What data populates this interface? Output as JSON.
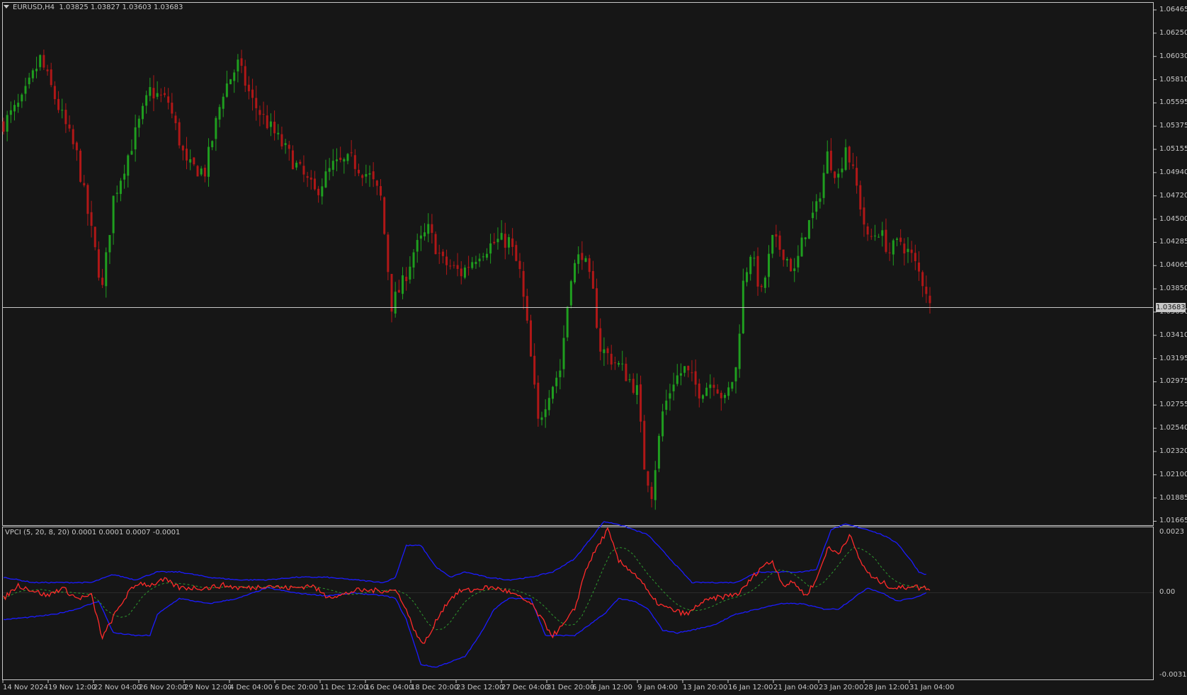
{
  "main_header": {
    "symbol": "EURUSD,H4",
    "ohlc": "1.03825 1.03827 1.03603 1.03683"
  },
  "indicator_header": "VPCI (5, 20, 8, 20) 0.0001 0.0001 0.0007 -0.0001",
  "current_price": "1.03683",
  "price_axis": [
    "1.06465",
    "1.06250",
    "1.06030",
    "1.05810",
    "1.05595",
    "1.05375",
    "1.05155",
    "1.04940",
    "1.04720",
    "1.04500",
    "1.04285",
    "1.04065",
    "1.03850",
    "1.03630",
    "1.03410",
    "1.03195",
    "1.02975",
    "1.02755",
    "1.02540",
    "1.02320",
    "1.02100",
    "1.01885",
    "1.01665"
  ],
  "indicator_axis": [
    "0.0023",
    "0.00",
    "-0.0031"
  ],
  "time_axis": [
    "14 Nov 2024",
    "19 Nov 12:00",
    "22 Nov 04:00",
    "26 Nov 20:00",
    "29 Nov 12:00",
    "4 Dec 04:00",
    "6 Dec 20:00",
    "11 Dec 12:00",
    "16 Dec 04:00",
    "18 Dec 20:00",
    "23 Dec 12:00",
    "27 Dec 04:00",
    "31 Dec 20:00",
    "6 Jan 12:00",
    "9 Jan 04:00",
    "13 Jan 20:00",
    "16 Jan 12:00",
    "21 Jan 04:00",
    "23 Jan 20:00",
    "28 Jan 12:00",
    "31 Jan 04:00"
  ],
  "colors": {
    "background": "#161616",
    "bull": "#1f9e1f",
    "bear": "#b01717",
    "vpci": "#ff2a2a",
    "signal": "#2e9a2e",
    "bands": "#1c1cff",
    "grid_text": "#c8c8c8"
  },
  "chart_data": {
    "type": "candlestick",
    "price_range": [
      1.01665,
      1.06465
    ],
    "close_anchors": [
      [
        0,
        1.054
      ],
      [
        5,
        1.056
      ],
      [
        10,
        1.06
      ],
      [
        15,
        1.0555
      ],
      [
        20,
        1.051
      ],
      [
        25,
        1.042
      ],
      [
        27,
        1.0385
      ],
      [
        30,
        1.047
      ],
      [
        35,
        1.052
      ],
      [
        40,
        1.057
      ],
      [
        45,
        1.056
      ],
      [
        50,
        1.05
      ],
      [
        55,
        1.0495
      ],
      [
        60,
        1.057
      ],
      [
        64,
        1.0595
      ],
      [
        68,
        1.056
      ],
      [
        72,
        1.054
      ],
      [
        76,
        1.052
      ],
      [
        80,
        1.05
      ],
      [
        85,
        1.0475
      ],
      [
        90,
        1.05
      ],
      [
        95,
        1.0505
      ],
      [
        100,
        1.049
      ],
      [
        103,
        1.047
      ],
      [
        106,
        1.037
      ],
      [
        109,
        1.039
      ],
      [
        112,
        1.042
      ],
      [
        116,
        1.044
      ],
      [
        120,
        1.041
      ],
      [
        125,
        1.04
      ],
      [
        130,
        1.042
      ],
      [
        135,
        1.043
      ],
      [
        138,
        1.043
      ],
      [
        141,
        1.04
      ],
      [
        143,
        1.035
      ],
      [
        146,
        1.026
      ],
      [
        149,
        1.029
      ],
      [
        152,
        1.031
      ],
      [
        155,
        1.04
      ],
      [
        158,
        1.042
      ],
      [
        161,
        1.038
      ],
      [
        163,
        1.033
      ],
      [
        166,
        1.032
      ],
      [
        169,
        1.031
      ],
      [
        173,
        1.029
      ],
      [
        175,
        1.022
      ],
      [
        177,
        1.0195
      ],
      [
        180,
        1.027
      ],
      [
        183,
        1.03
      ],
      [
        186,
        1.031
      ],
      [
        190,
        1.029
      ],
      [
        194,
        1.03
      ],
      [
        197,
        1.028
      ],
      [
        200,
        1.031
      ],
      [
        202,
        1.039
      ],
      [
        204,
        1.042
      ],
      [
        207,
        1.038
      ],
      [
        210,
        1.043
      ],
      [
        213,
        1.042
      ],
      [
        216,
        1.04
      ],
      [
        219,
        1.044
      ],
      [
        222,
        1.046
      ],
      [
        225,
        1.051
      ],
      [
        228,
        1.049
      ],
      [
        230,
        1.052
      ],
      [
        233,
        1.048
      ],
      [
        236,
        1.043
      ],
      [
        239,
        1.044
      ],
      [
        242,
        1.042
      ],
      [
        245,
        1.043
      ],
      [
        248,
        1.0415
      ],
      [
        250,
        1.04
      ],
      [
        252,
        1.0385
      ],
      [
        253,
        1.0368
      ]
    ],
    "indicator_range": [
      -0.0031,
      0.0023
    ],
    "vpci_anchors": [
      [
        0,
        -0.0002
      ],
      [
        4,
        0.0003
      ],
      [
        8,
        0.0001
      ],
      [
        12,
        -0.0001
      ],
      [
        16,
        0.0002
      ],
      [
        20,
        -0.0002
      ],
      [
        24,
        -0.0001
      ],
      [
        27,
        -0.0017
      ],
      [
        30,
        -0.0009
      ],
      [
        34,
        0.0
      ],
      [
        37,
        0.0004
      ],
      [
        40,
        0.0003
      ],
      [
        44,
        0.0005
      ],
      [
        48,
        0.0002
      ],
      [
        52,
        0.0002
      ],
      [
        56,
        0.0002
      ],
      [
        60,
        0.0003
      ],
      [
        64,
        0.0002
      ],
      [
        68,
        0.0002
      ],
      [
        72,
        0.0003
      ],
      [
        76,
        0.0002
      ],
      [
        80,
        0.0002
      ],
      [
        84,
        0.0003
      ],
      [
        88,
        -0.0001
      ],
      [
        92,
        -0.0001
      ],
      [
        96,
        0.0001
      ],
      [
        100,
        0.0001
      ],
      [
        104,
        0.0001
      ],
      [
        107,
        0.0001
      ],
      [
        109,
        -0.0003
      ],
      [
        111,
        -0.001
      ],
      [
        114,
        -0.0019
      ],
      [
        116,
        -0.0017
      ],
      [
        119,
        -0.0008
      ],
      [
        122,
        -0.0002
      ],
      [
        125,
        0.0001
      ],
      [
        128,
        0.0001
      ],
      [
        131,
        0.0002
      ],
      [
        134,
        0.0002
      ],
      [
        137,
        0.0001
      ],
      [
        140,
        -0.0001
      ],
      [
        144,
        -0.0004
      ],
      [
        148,
        -0.0012
      ],
      [
        150,
        -0.0016
      ],
      [
        153,
        -0.0012
      ],
      [
        156,
        -0.0006
      ],
      [
        159,
        0.0009
      ],
      [
        162,
        0.0017
      ],
      [
        165,
        0.0024
      ],
      [
        168,
        0.0012
      ],
      [
        171,
        0.0009
      ],
      [
        174,
        0.0005
      ],
      [
        177,
        -0.0002
      ],
      [
        180,
        -0.0005
      ],
      [
        184,
        -0.0007
      ],
      [
        187,
        -0.0008
      ],
      [
        190,
        -0.0004
      ],
      [
        194,
        -0.0002
      ],
      [
        198,
        -0.0001
      ],
      [
        201,
        0.0
      ],
      [
        204,
        0.0005
      ],
      [
        207,
        0.001
      ],
      [
        210,
        0.0012
      ],
      [
        213,
        0.0003
      ],
      [
        216,
        0.0004
      ],
      [
        219,
        -0.0001
      ],
      [
        222,
        0.0005
      ],
      [
        225,
        0.0017
      ],
      [
        228,
        0.0015
      ],
      [
        231,
        0.0022
      ],
      [
        234,
        0.0012
      ],
      [
        237,
        0.0006
      ],
      [
        240,
        0.0004
      ],
      [
        243,
        0.0002
      ],
      [
        246,
        0.0002
      ],
      [
        248,
        0.0003
      ],
      [
        250,
        0.0002
      ],
      [
        253,
        0.0002
      ]
    ],
    "upper_band_anchors": [
      [
        0,
        0.0006
      ],
      [
        8,
        0.0004
      ],
      [
        16,
        0.0004
      ],
      [
        24,
        0.0004
      ],
      [
        30,
        0.0007
      ],
      [
        36,
        0.0005
      ],
      [
        42,
        0.0008
      ],
      [
        48,
        0.0008
      ],
      [
        56,
        0.0006
      ],
      [
        64,
        0.0005
      ],
      [
        72,
        0.0005
      ],
      [
        80,
        0.0006
      ],
      [
        88,
        0.0006
      ],
      [
        96,
        0.0005
      ],
      [
        104,
        0.0004
      ],
      [
        107,
        0.0006
      ],
      [
        110,
        0.0018
      ],
      [
        114,
        0.0018
      ],
      [
        118,
        0.001
      ],
      [
        122,
        0.0006
      ],
      [
        126,
        0.0008
      ],
      [
        132,
        0.0006
      ],
      [
        138,
        0.0005
      ],
      [
        144,
        0.0006
      ],
      [
        150,
        0.0008
      ],
      [
        156,
        0.0013
      ],
      [
        160,
        0.002
      ],
      [
        164,
        0.0027
      ],
      [
        168,
        0.0026
      ],
      [
        172,
        0.0024
      ],
      [
        176,
        0.0022
      ],
      [
        180,
        0.0016
      ],
      [
        184,
        0.001
      ],
      [
        188,
        0.0004
      ],
      [
        192,
        0.0004
      ],
      [
        200,
        0.0004
      ],
      [
        206,
        0.0008
      ],
      [
        212,
        0.0008
      ],
      [
        218,
        0.0008
      ],
      [
        222,
        0.0009
      ],
      [
        226,
        0.0024
      ],
      [
        230,
        0.0026
      ],
      [
        236,
        0.0024
      ],
      [
        240,
        0.0022
      ],
      [
        244,
        0.0019
      ],
      [
        248,
        0.0012
      ],
      [
        250,
        0.0008
      ],
      [
        252,
        0.0007
      ]
    ],
    "lower_band_anchors": [
      [
        0,
        -0.001
      ],
      [
        8,
        -0.0009
      ],
      [
        14,
        -0.0008
      ],
      [
        20,
        -0.0006
      ],
      [
        26,
        -0.0003
      ],
      [
        30,
        -0.0015
      ],
      [
        36,
        -0.0016
      ],
      [
        40,
        -0.0016
      ],
      [
        42,
        -0.0008
      ],
      [
        48,
        -0.0002
      ],
      [
        56,
        -0.0004
      ],
      [
        64,
        -0.0002
      ],
      [
        72,
        0.0002
      ],
      [
        80,
        0.0
      ],
      [
        88,
        -0.0001
      ],
      [
        96,
        0.0
      ],
      [
        104,
        -0.0001
      ],
      [
        107,
        -0.0002
      ],
      [
        110,
        -0.001
      ],
      [
        114,
        -0.0027
      ],
      [
        118,
        -0.0028
      ],
      [
        122,
        -0.0026
      ],
      [
        126,
        -0.0024
      ],
      [
        130,
        -0.0016
      ],
      [
        134,
        -0.0006
      ],
      [
        138,
        -0.0002
      ],
      [
        144,
        -0.0002
      ],
      [
        148,
        -0.0016
      ],
      [
        152,
        -0.0016
      ],
      [
        156,
        -0.0016
      ],
      [
        160,
        -0.0012
      ],
      [
        164,
        -0.0008
      ],
      [
        168,
        -0.0002
      ],
      [
        172,
        -0.0003
      ],
      [
        176,
        -0.0006
      ],
      [
        180,
        -0.0014
      ],
      [
        184,
        -0.0015
      ],
      [
        188,
        -0.0014
      ],
      [
        194,
        -0.0012
      ],
      [
        200,
        -0.0008
      ],
      [
        206,
        -0.0006
      ],
      [
        212,
        -0.0004
      ],
      [
        218,
        -0.0004
      ],
      [
        224,
        -0.0006
      ],
      [
        228,
        -0.0006
      ],
      [
        232,
        -0.0002
      ],
      [
        236,
        0.0002
      ],
      [
        240,
        0.0
      ],
      [
        244,
        -0.0003
      ],
      [
        248,
        -0.0002
      ],
      [
        250,
        -0.0001
      ],
      [
        252,
        0.0
      ]
    ]
  }
}
